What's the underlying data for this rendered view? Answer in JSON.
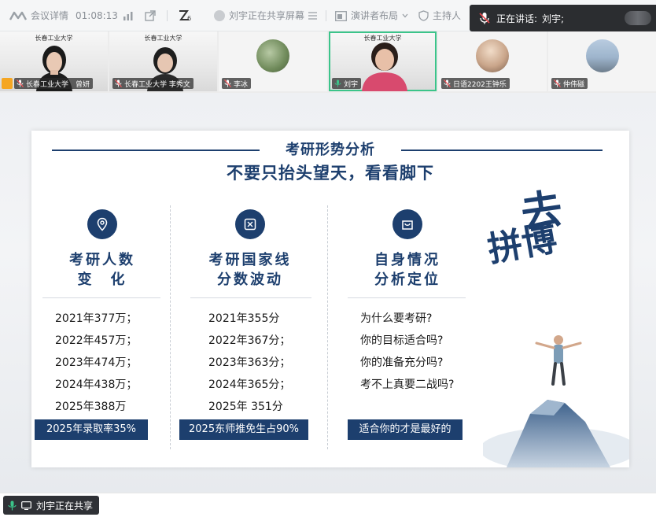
{
  "toolbar": {
    "meeting_info": "会议详情",
    "timer": "01:08:13",
    "sharing_status": "刘宇正在共享屏幕",
    "presenter_layout": "演讲者布局",
    "host_label": "主持人"
  },
  "speaking": {
    "label": "正在讲话:",
    "name": "刘宇;"
  },
  "participants": [
    {
      "school": "长春工业大学",
      "name": "长春工业大学　曾妍"
    },
    {
      "school": "长春工业大学",
      "name": "长春工业大学 李秀文"
    },
    {
      "school": "",
      "name": "李冰"
    },
    {
      "school": "长春工业大学",
      "name": "刘宇"
    },
    {
      "school": "",
      "name": "日语2202王钟乐"
    },
    {
      "school": "",
      "name": "仲伟磁"
    }
  ],
  "slide": {
    "title": "考研形势分析",
    "subtitle": "不要只抬头望天，看看脚下",
    "columns": [
      {
        "heading_line1": "考研人数",
        "heading_line2": "变　化",
        "items": [
          "2021年377万；",
          "2022年457万；",
          "2023年474万；",
          "2024年438万；",
          "2025年388万"
        ],
        "tag": "2025年录取率35%"
      },
      {
        "heading_line1": "考研国家线",
        "heading_line2": "分数波动",
        "items": [
          "2021年355分",
          "2022年367分；",
          "2023年363分；",
          "2024年365分；",
          "2025年 351分"
        ],
        "tag": "2025东师推免生占90%"
      },
      {
        "heading_line1": "自身情况",
        "heading_line2": "分析定位",
        "items": [
          "为什么要考研?",
          "你的目标适合吗?",
          "你的准备充分吗?",
          "考不上真要二战吗?"
        ],
        "tag": "适合你的才是最好的"
      }
    ],
    "calligraphy_top": "去",
    "calligraphy_bottom": "拼博"
  },
  "bottom": {
    "share_status": "刘宇正在共享"
  },
  "colors": {
    "navy": "#1d3f6e",
    "active_green": "#3bc48a"
  }
}
